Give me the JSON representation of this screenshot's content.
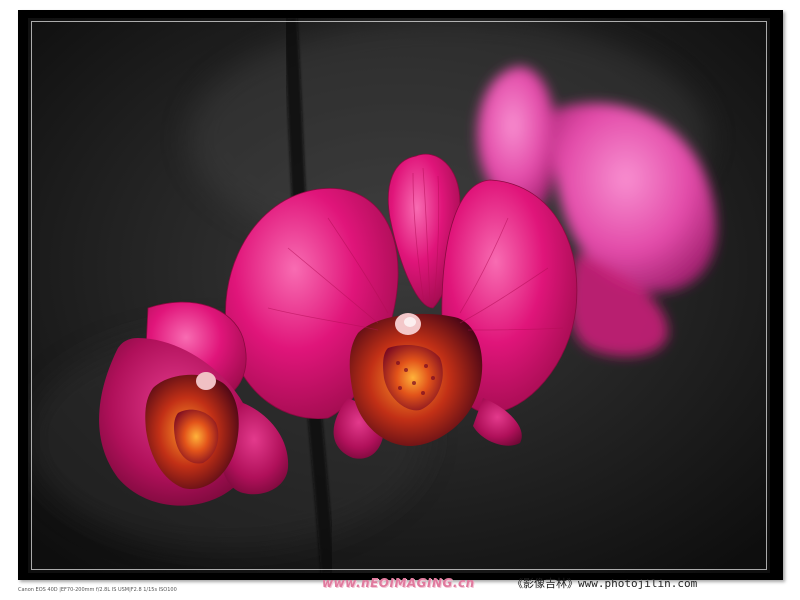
{
  "photo": {
    "subject_icon": "orchid-photo",
    "colors": {
      "background": "#1a1a1a",
      "petal_magenta": "#e0116f",
      "petal_light": "#f25aa0",
      "lip_orange": "#e8631a",
      "frame": "#000000"
    }
  },
  "footer": {
    "exif": "Canon EOS 40D |EF70-200mm f/2.8L IS USM|F2.8 1/15s ISO100",
    "watermark": "www.nEOIMAGING.cn",
    "credit": "《影像吉林》www.photojilin.com"
  }
}
